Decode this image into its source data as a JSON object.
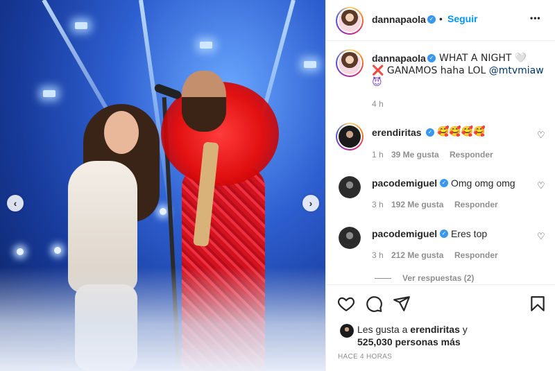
{
  "post_owner": {
    "username": "dannapaola",
    "follow_label": "Seguir",
    "more_label": "•••",
    "separator": "•"
  },
  "caption": {
    "username": "dannapaola",
    "text_line1": "WHAT A NIGHT 🤍",
    "text_line2": "❌ GANAMOS haha LOL ",
    "mention": "@mtvmiaw",
    "text_line3": "😈",
    "time": "4 h"
  },
  "comments": [
    {
      "username": "erendiritas",
      "text": "🥰🥰🥰🥰",
      "time": "1 h",
      "likes": "39 Me gusta",
      "reply_label": "Responder"
    },
    {
      "username": "pacodemiguel",
      "text": "Omg omg omg",
      "time": "3 h",
      "likes": "192 Me gusta",
      "reply_label": "Responder"
    },
    {
      "username": "pacodemiguel",
      "text": "Eres top",
      "time": "3 h",
      "likes": "212 Me gusta",
      "reply_label": "Responder",
      "view_replies": "Ver respuestas (2)"
    }
  ],
  "likes_summary": {
    "prefix": "Les gusta a ",
    "user": "erendiritas",
    "suffix": " y",
    "count_line": "525,030 personas más"
  },
  "timestamp": "HACE 4 HORAS",
  "icons": {
    "like": "heart-icon",
    "comment": "comment-icon",
    "share": "share-icon",
    "save": "bookmark-icon",
    "prev": "chevron-left-icon",
    "next": "chevron-right-icon",
    "prev_glyph": "‹",
    "next_glyph": "›",
    "small_heart_glyph": "♡"
  },
  "colors": {
    "accent": "#0095f6",
    "verified": "#3897f0",
    "secondary_text": "#8e8e8e",
    "mention": "#00376b"
  }
}
